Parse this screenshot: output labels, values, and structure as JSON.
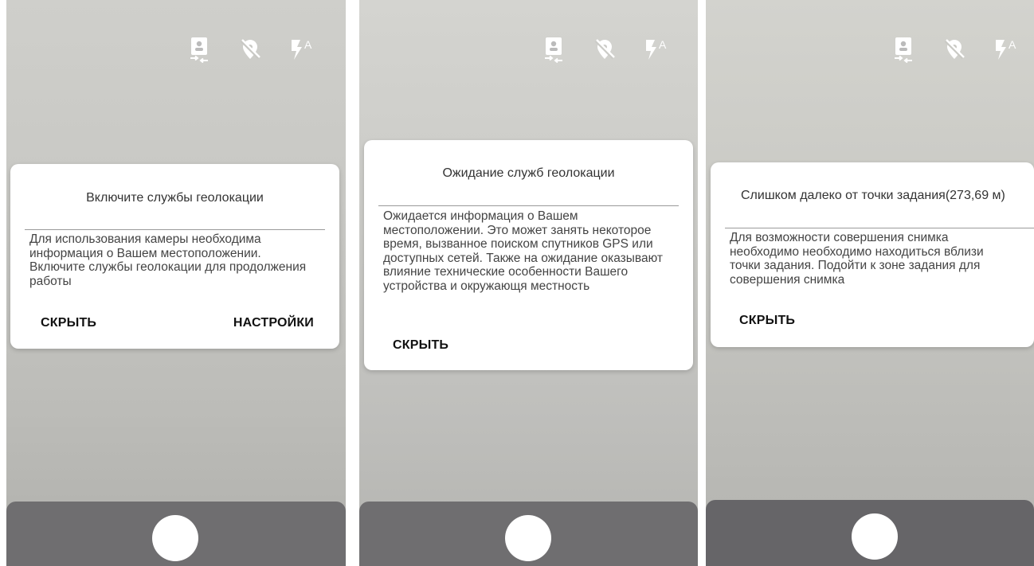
{
  "screens": [
    {
      "toolbar": {
        "icons": [
          "switch-camera-icon",
          "location-off-icon",
          "flash-auto-icon"
        ]
      },
      "dialog": {
        "title": "Включите службы геолокации",
        "body": "Для использования камеры необходима информация о Вашем местоположении. Включите службы геолокации для продолжения работы",
        "buttons": {
          "hide": "СКРЫТЬ",
          "settings": "НАСТРОЙКИ"
        }
      }
    },
    {
      "toolbar": {
        "icons": [
          "switch-camera-icon",
          "location-off-icon",
          "flash-auto-icon"
        ]
      },
      "dialog": {
        "title": "Ожидание служб геолокации",
        "body": "Ожидается информация о Вашем местоположении. Это может занять некоторое время, вызванное поиском спутников GPS или доступных сетей. Также на ожидание оказывают влияние технические особенности Вашего устройства и окружающя местность",
        "buttons": {
          "hide": "СКРЫТЬ"
        }
      }
    },
    {
      "toolbar": {
        "icons": [
          "switch-camera-icon",
          "location-off-icon",
          "flash-auto-icon"
        ]
      },
      "dialog": {
        "title": "Слишком далеко от точки задания(273,69 м)",
        "body": "Для возможности совершения снимка необходимо необходимо находиться вблизи точки задания. Подойти к зоне задания для совершения снимка",
        "buttons": {
          "hide": "СКРЫТЬ"
        }
      }
    }
  ],
  "colors": {
    "dialog_bg": "#ffffff",
    "bottom_bar": "#6f6e70",
    "icon": "#ffffff"
  }
}
